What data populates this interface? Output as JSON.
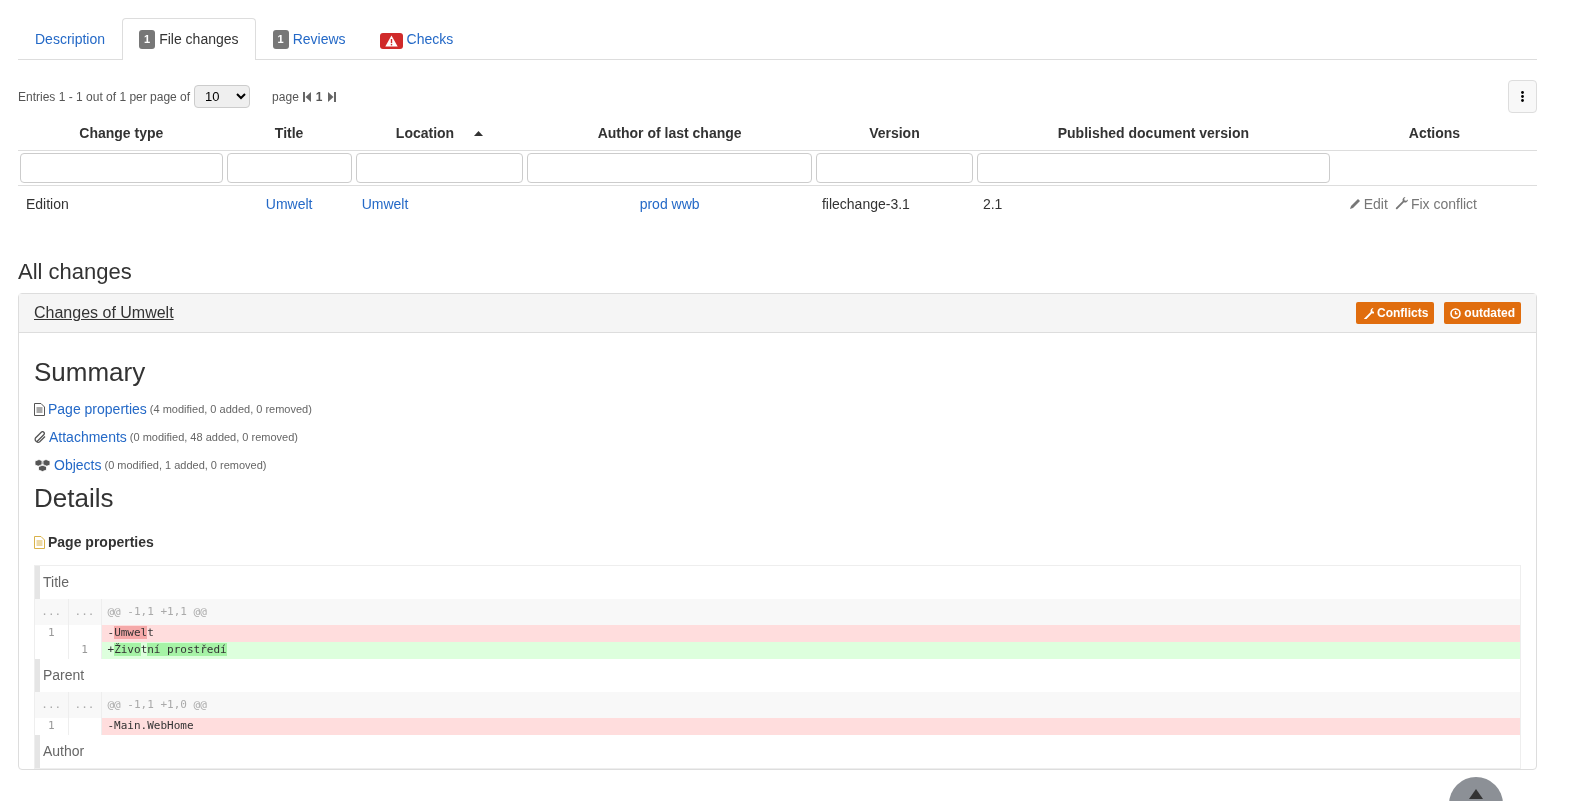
{
  "tabs": [
    {
      "label": "Description",
      "kind": "plain",
      "selected": false
    },
    {
      "label": "File changes",
      "kind": "count",
      "count": "1",
      "selected": true
    },
    {
      "label": "Reviews",
      "kind": "count",
      "count": "1",
      "selected": false
    },
    {
      "label": "Checks",
      "kind": "warning",
      "selected": false
    }
  ],
  "pagination": {
    "entries_text": "Entries 1 - 1 out of 1 per page of",
    "page_size": "10",
    "page_label": "page",
    "current_page": "1"
  },
  "table": {
    "columns": [
      {
        "label": "Change type",
        "sorted": false
      },
      {
        "label": "Title",
        "sorted": false
      },
      {
        "label": "Location",
        "sorted": true
      },
      {
        "label": "Author of last change",
        "sorted": false
      },
      {
        "label": "Version",
        "sorted": false
      },
      {
        "label": "Published document version",
        "sorted": false
      },
      {
        "label": "Actions",
        "sorted": false
      }
    ],
    "rows": [
      {
        "change_type": "Edition",
        "title": "Umwelt",
        "location": "Umwelt",
        "author": "prod wwb",
        "version": "filechange-3.1",
        "published_version": "2.1",
        "actions": [
          {
            "kind": "edit",
            "label": "Edit"
          },
          {
            "kind": "fix",
            "label": "Fix conflict"
          }
        ]
      }
    ]
  },
  "all_changes_heading": "All changes",
  "change_panel": {
    "title": "Changes of Umwelt",
    "badges": [
      {
        "kind": "conflicts",
        "label": "Conflicts"
      },
      {
        "kind": "outdated",
        "label": "outdated"
      }
    ],
    "summary_heading": "Summary",
    "summary_items": [
      {
        "kind": "page",
        "label": "Page properties",
        "stats": "(4 modified, 0 added, 0 removed)"
      },
      {
        "kind": "attachment",
        "label": "Attachments",
        "stats": "(0 modified, 48 added, 0 removed)"
      },
      {
        "kind": "objects",
        "label": "Objects",
        "stats": "(0 modified, 1 added, 0 removed)"
      }
    ],
    "details_heading": "Details",
    "details_section": "Page properties",
    "properties": [
      {
        "name": "Title",
        "diff": [
          {
            "kind": "hunk",
            "old_no": "...",
            "new_no": "...",
            "text": "@@ -1,1 +1,1 @@"
          },
          {
            "kind": "removed",
            "old_no": "1",
            "segments": [
              {
                "text": "-",
                "changed": false
              },
              {
                "text": "Umwel",
                "changed": true
              },
              {
                "text": "t",
                "changed": false
              }
            ]
          },
          {
            "kind": "added",
            "new_no": "1",
            "segments": [
              {
                "text": "+",
                "changed": false
              },
              {
                "text": "Živo",
                "changed": true
              },
              {
                "text": "t",
                "changed": false
              },
              {
                "text": "ní prostředí",
                "changed": true
              }
            ]
          }
        ]
      },
      {
        "name": "Parent",
        "diff": [
          {
            "kind": "hunk",
            "old_no": "...",
            "new_no": "...",
            "text": "@@ -1,1 +1,0 @@"
          },
          {
            "kind": "removed",
            "old_no": "1",
            "text": "-Main.WebHome"
          }
        ]
      },
      {
        "name": "Author"
      }
    ]
  }
}
